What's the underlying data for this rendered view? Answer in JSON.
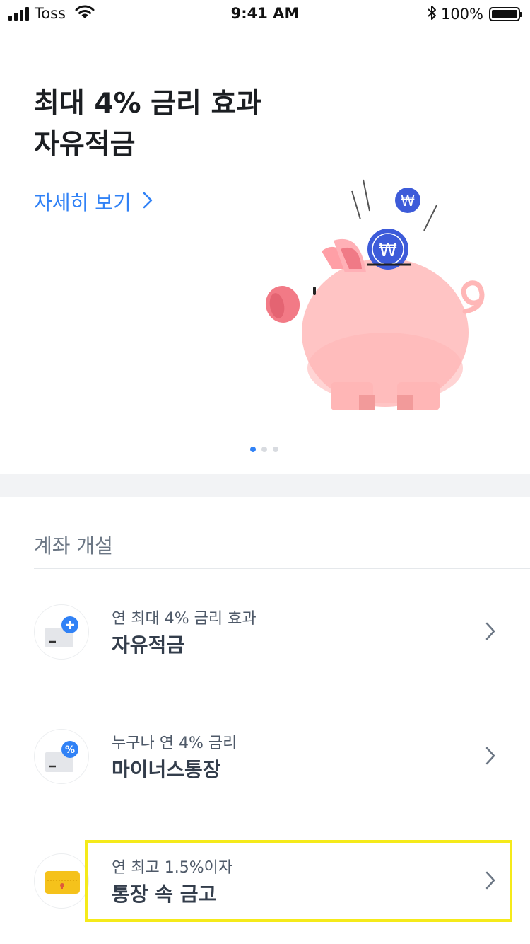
{
  "status_bar": {
    "carrier": "Toss",
    "time": "9:41 AM",
    "battery": "100%"
  },
  "hero": {
    "title_line1": "최대 4% 금리 효과",
    "title_line2": "자유적금",
    "link_label": "자세히 보기",
    "carousel_page": 1,
    "carousel_total": 3
  },
  "section": {
    "title": "계좌 개설"
  },
  "items": [
    {
      "subtitle": "연 최대 4% 금리 효과",
      "title": "자유적금",
      "icon": "savings-plus-icon"
    },
    {
      "subtitle": "누구나 연 4% 금리",
      "title": "마이너스통장",
      "icon": "minus-account-percent-icon"
    },
    {
      "subtitle": "연 최고 1.5%이자",
      "title": "통장 속 금고",
      "icon": "safe-box-icon"
    }
  ],
  "colors": {
    "accent": "#3182f6",
    "pig": "#ffc8c8",
    "highlight": "#f5ea1a"
  }
}
